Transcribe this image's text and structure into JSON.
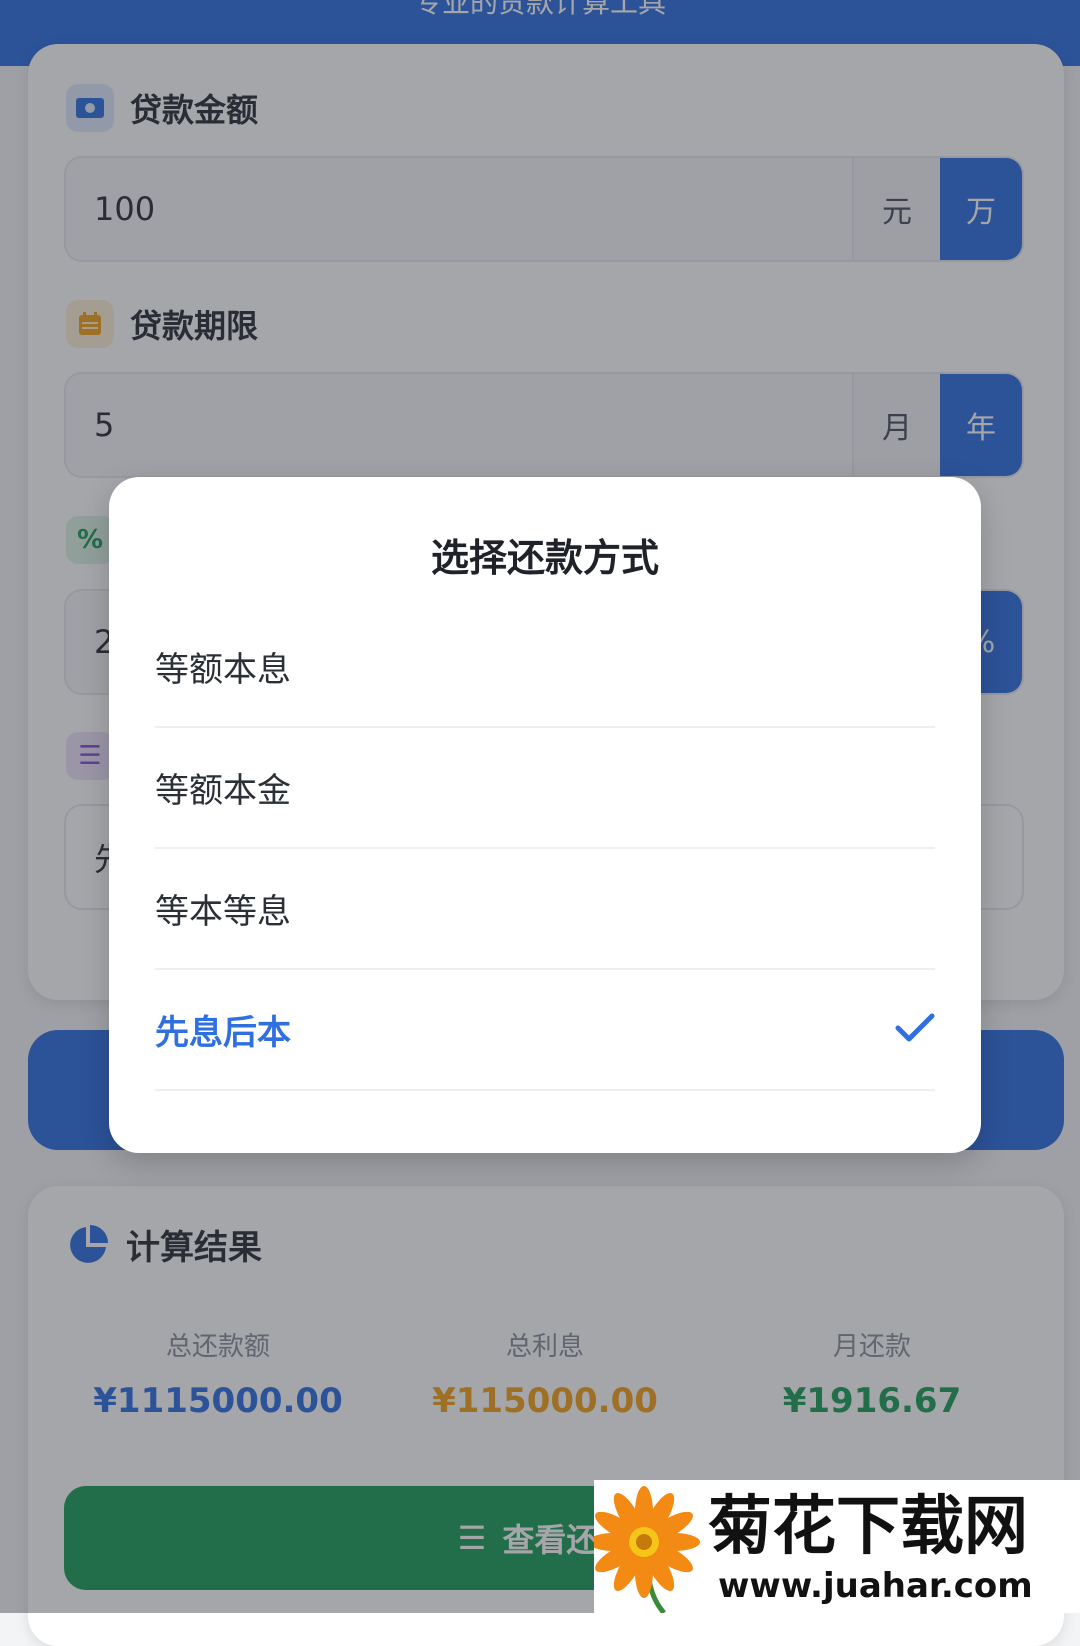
{
  "header": {
    "title": "专业的贷款计算工具"
  },
  "form": {
    "amount": {
      "label": "贷款金额",
      "value": "100",
      "units": [
        "元",
        "万"
      ],
      "active_unit": "万"
    },
    "term": {
      "label": "贷款期限",
      "value": "5",
      "units": [
        "月",
        "年"
      ],
      "active_unit": "年"
    },
    "rate": {
      "value_visible": "2",
      "unit": "%"
    },
    "method": {
      "value_visible": "先"
    }
  },
  "result": {
    "title": "计算结果",
    "stats": [
      {
        "label": "总还款额",
        "value": "¥1115000.00",
        "color": "#2f6fe0"
      },
      {
        "label": "总利息",
        "value": "¥115000.00",
        "color": "#f2a21b"
      },
      {
        "label": "月还款",
        "value": "¥1916.67",
        "color": "#1e9e5a"
      }
    ],
    "view_button": "查看还款"
  },
  "modal": {
    "title": "选择还款方式",
    "options": [
      {
        "label": "等额本息",
        "selected": false
      },
      {
        "label": "等额本金",
        "selected": false
      },
      {
        "label": "等本等息",
        "selected": false
      },
      {
        "label": "先息后本",
        "selected": true
      }
    ]
  },
  "watermark": {
    "name": "菊花下载网",
    "url": "www.juahar.com"
  },
  "colors": {
    "primary": "#2f6fe0",
    "green": "#1e9e5a",
    "orange": "#f2a21b"
  },
  "icons": [
    "money-icon",
    "calendar-icon",
    "percent-icon",
    "list-icon",
    "pie-chart-icon",
    "check-icon",
    "flower-logo"
  ]
}
